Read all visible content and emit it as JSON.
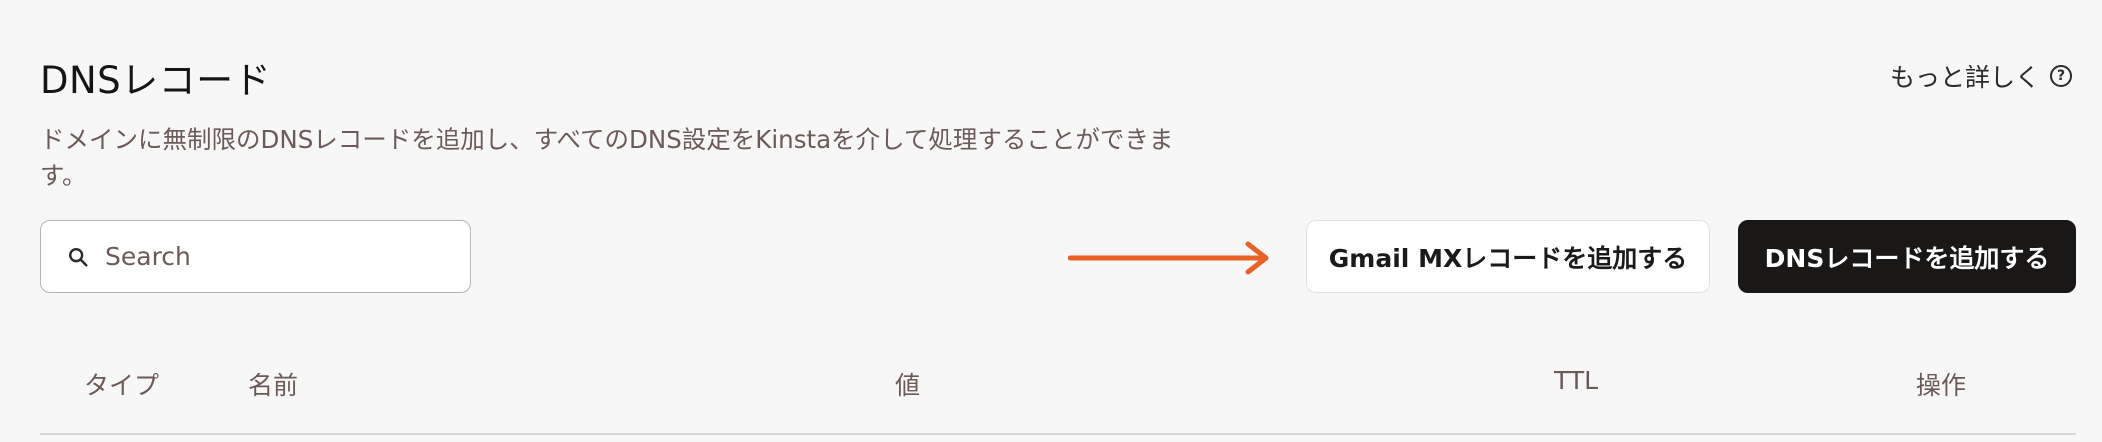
{
  "header": {
    "title": "DNSレコード",
    "learn_more": "もっと詳しく",
    "help_icon": "question-circle-icon",
    "description": "ドメインに無制限のDNSレコードを追加し、すべてのDNS設定をKinstaを介して処理することができます。"
  },
  "search": {
    "placeholder": "Search",
    "value": "",
    "icon": "search-icon"
  },
  "annotation": {
    "arrow_color": "#e8622a"
  },
  "buttons": {
    "add_gmail_mx": "Gmail MXレコードを追加する",
    "add_dns": "DNSレコードを追加する"
  },
  "table": {
    "columns": [
      "タイプ",
      "名前",
      "値",
      "TTL",
      "操作"
    ]
  },
  "colors": {
    "primary_button": "#1a1717",
    "muted_text": "#6b5a58",
    "background": "#f7f7f7"
  }
}
